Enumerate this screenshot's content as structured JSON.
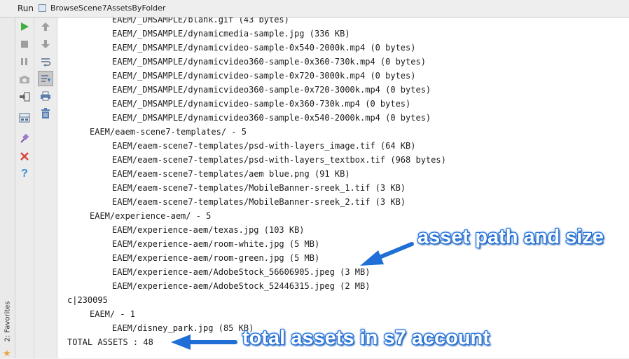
{
  "window": {
    "run_label": "Run",
    "tab_label": "BrowseScene7AssetsByFolder"
  },
  "favorites": {
    "label": "2: Favorites"
  },
  "toolbar": {
    "left": [
      "run-icon",
      "stop-icon",
      "pause-icon",
      "camera-icon",
      "restore-layout-icon",
      "layout-icon",
      "pin-icon",
      "close-icon",
      "help-icon"
    ],
    "right": [
      "up-arrow-icon",
      "down-arrow-icon",
      "soft-wrap-icon",
      "scroll-to-end-icon",
      "print-icon",
      "clear-icon"
    ]
  },
  "console": {
    "lines": [
      {
        "indent": 2,
        "text": "EAEM/_DMSAMPLE/blank.gif (43 bytes)"
      },
      {
        "indent": 2,
        "text": "EAEM/_DMSAMPLE/dynamicmedia-sample.jpg (336 KB)"
      },
      {
        "indent": 2,
        "text": "EAEM/_DMSAMPLE/dynamicvideo-sample-0x540-2000k.mp4 (0 bytes)"
      },
      {
        "indent": 2,
        "text": "EAEM/_DMSAMPLE/dynamicvideo360-sample-0x360-730k.mp4 (0 bytes)"
      },
      {
        "indent": 2,
        "text": "EAEM/_DMSAMPLE/dynamicvideo-sample-0x720-3000k.mp4 (0 bytes)"
      },
      {
        "indent": 2,
        "text": "EAEM/_DMSAMPLE/dynamicvideo360-sample-0x720-3000k.mp4 (0 bytes)"
      },
      {
        "indent": 2,
        "text": "EAEM/_DMSAMPLE/dynamicvideo-sample-0x360-730k.mp4 (0 bytes)"
      },
      {
        "indent": 2,
        "text": "EAEM/_DMSAMPLE/dynamicvideo360-sample-0x540-2000k.mp4 (0 bytes)"
      },
      {
        "indent": 1,
        "text": "EAEM/eaem-scene7-templates/ - 5"
      },
      {
        "indent": 2,
        "text": "EAEM/eaem-scene7-templates/psd-with-layers_image.tif (64 KB)"
      },
      {
        "indent": 2,
        "text": "EAEM/eaem-scene7-templates/psd-with-layers_textbox.tif (968 bytes)"
      },
      {
        "indent": 2,
        "text": "EAEM/eaem-scene7-templates/aem blue.png (91 KB)"
      },
      {
        "indent": 2,
        "text": "EAEM/eaem-scene7-templates/MobileBanner-sreek_1.tif (3 KB)"
      },
      {
        "indent": 2,
        "text": "EAEM/eaem-scene7-templates/MobileBanner-sreek_2.tif (3 KB)"
      },
      {
        "indent": 1,
        "text": "EAEM/experience-aem/ - 5"
      },
      {
        "indent": 2,
        "text": "EAEM/experience-aem/texas.jpg (103 KB)"
      },
      {
        "indent": 2,
        "text": "EAEM/experience-aem/room-white.jpg (5 MB)"
      },
      {
        "indent": 2,
        "text": "EAEM/experience-aem/room-green.jpg (5 MB)"
      },
      {
        "indent": 2,
        "text": "EAEM/experience-aem/AdobeStock_56606905.jpeg (3 MB)"
      },
      {
        "indent": 2,
        "text": "EAEM/experience-aem/AdobeStock_52446315.jpeg (2 MB)"
      },
      {
        "indent": 0,
        "text": "c|230095"
      },
      {
        "indent": 1,
        "text": "EAEM/ - 1"
      },
      {
        "indent": 2,
        "text": "EAEM/disney_park.jpg (85 KB)"
      },
      {
        "indent": 0,
        "text": "TOTAL ASSETS : 48"
      }
    ]
  },
  "annotations": {
    "asset_callout": "asset path and size",
    "total_callout": "total assets in s7 account",
    "accent_color": "#1f6fd6"
  }
}
